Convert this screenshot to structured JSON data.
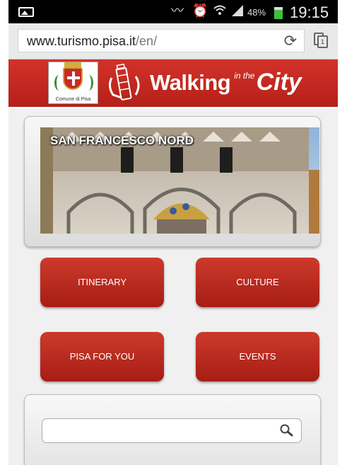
{
  "status_bar": {
    "battery_percent": "48%",
    "time": "19:15",
    "icons": [
      "image-notification-icon",
      "vibrate-icon",
      "alarm-icon",
      "wifi-icon",
      "signal-icon",
      "battery-icon"
    ]
  },
  "browser": {
    "url_domain": "www.turismo.pisa.it",
    "url_path": "/en/",
    "tab_count": "1",
    "icons": [
      "reload-icon",
      "tabs-icon"
    ]
  },
  "header": {
    "coat_of_arms_caption": "Comune di Pisa",
    "brand_walking": "Walking",
    "brand_in_the": "in the",
    "brand_city": "City"
  },
  "hero": {
    "title": "SAN FRANCESCO NORD"
  },
  "menu": {
    "itinerary": "ITINERARY",
    "culture": "CULTURE",
    "pisa_for_you": "PISA FOR YOU",
    "events": "EVENTS"
  },
  "search": {
    "value": "",
    "placeholder": "",
    "icon": "search-icon"
  },
  "colors": {
    "brand_red": "#c1271f",
    "button_red": "#b42619",
    "status_bar": "#000000",
    "battery_green": "#3fbf3f"
  }
}
